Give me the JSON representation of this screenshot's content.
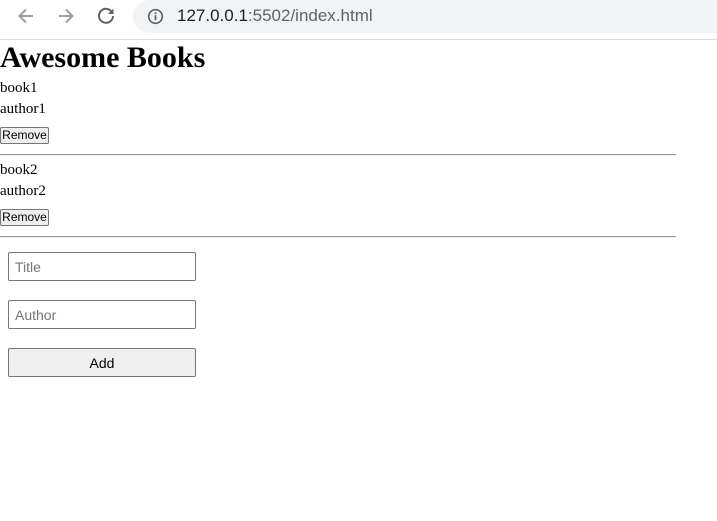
{
  "browser": {
    "url_host": "127.0.0.1",
    "url_rest": ":5502/index.html",
    "back_icon": "arrow-left-icon",
    "forward_icon": "arrow-right-icon",
    "reload_icon": "reload-icon",
    "site_info_icon": "info-icon",
    "icon_color": "#5f6368",
    "disabled_icon_color": "#9aa0a6",
    "omnibox_color": "#f1f3f4"
  },
  "page": {
    "title": "Awesome Books"
  },
  "books": [
    {
      "title": "book1",
      "author": "author1",
      "remove_label": "Remove"
    },
    {
      "title": "book2",
      "author": "author2",
      "remove_label": "Remove"
    }
  ],
  "form": {
    "title_placeholder": "Title",
    "title_value": "",
    "author_placeholder": "Author",
    "author_value": "",
    "add_label": "Add"
  }
}
